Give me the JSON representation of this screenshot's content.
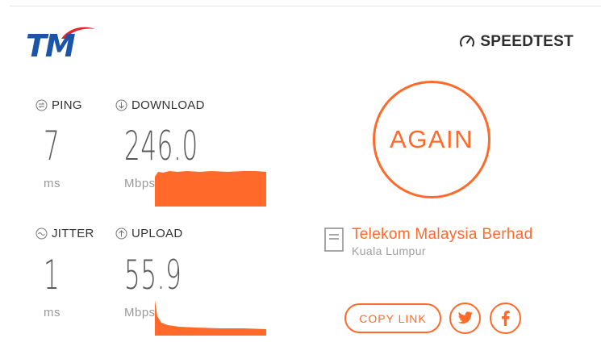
{
  "brand": {
    "logo_text": "TM",
    "speedtest_label": "SPEEDTEST"
  },
  "metrics": {
    "ping": {
      "label": "PING",
      "value": "7",
      "unit": "ms",
      "icon": "ping-icon"
    },
    "download": {
      "label": "DOWNLOAD",
      "value": "246.0",
      "unit": "Mbps",
      "icon": "download-icon"
    },
    "jitter": {
      "label": "JITTER",
      "value": "1",
      "unit": "ms",
      "icon": "jitter-icon"
    },
    "upload": {
      "label": "UPLOAD",
      "value": "55.9",
      "unit": "Mbps",
      "icon": "upload-icon"
    }
  },
  "actions": {
    "again_label": "AGAIN",
    "copy_link_label": "COPY LINK"
  },
  "provider": {
    "name": "Telekom Malaysia Berhad",
    "location": "Kuala Lumpur"
  },
  "social": {
    "twitter": "twitter-icon",
    "facebook": "facebook-icon"
  },
  "colors": {
    "accent": "#ff6a2b",
    "logo_blue": "#1a55a8",
    "logo_red": "#e8242a"
  }
}
